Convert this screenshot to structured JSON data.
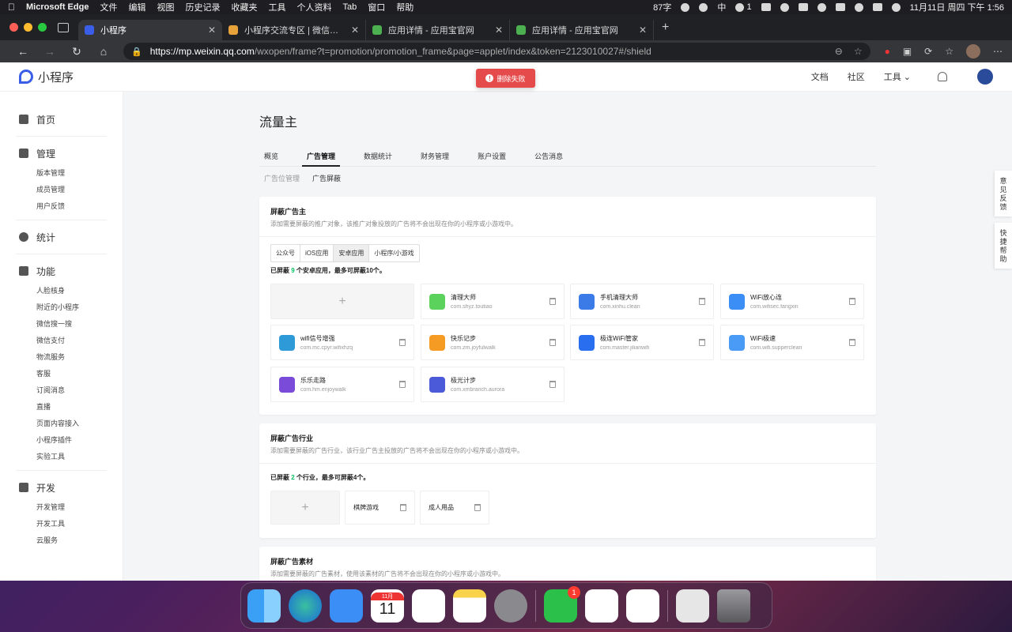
{
  "menubar": {
    "app": "Microsoft Edge",
    "items": [
      "文件",
      "编辑",
      "视图",
      "历史记录",
      "收藏夹",
      "工具",
      "个人资料",
      "Tab",
      "窗口",
      "帮助"
    ],
    "status_left": "87字",
    "status_ime": "中",
    "wechat_count": "1",
    "clock": "11月11日 周四 下午 1:56"
  },
  "browser": {
    "tabs": [
      {
        "title": "小程序",
        "color": "#3a5ee8"
      },
      {
        "title": "小程序交流专区 | 微信开放社区",
        "color": "#e8a23a"
      },
      {
        "title": "应用详情 - 应用宝官网",
        "color": "#4caf50"
      },
      {
        "title": "应用详情 - 应用宝官网",
        "color": "#4caf50"
      }
    ],
    "url_host": "https://mp.weixin.qq.com",
    "url_path": "/wxopen/frame?t=promotion/promotion_frame&page=applet/index&token=2123010027#/shield"
  },
  "topnav": {
    "logo": "小程序",
    "links": [
      "文档",
      "社区",
      "工具"
    ]
  },
  "toast": "删除失败",
  "sidebar": [
    {
      "title": "首页",
      "items": []
    },
    {
      "title": "管理",
      "items": [
        "版本管理",
        "成员管理",
        "用户反馈"
      ]
    },
    {
      "title": "统计",
      "items": []
    },
    {
      "title": "功能",
      "items": [
        "人脸核身",
        "附近的小程序",
        "微信搜一搜",
        "微信支付",
        "物流服务",
        "客服",
        "订阅消息",
        "直播",
        "页面内容接入",
        "小程序插件",
        "实验工具"
      ]
    },
    {
      "title": "开发",
      "items": [
        "开发管理",
        "开发工具",
        "云服务"
      ]
    }
  ],
  "main": {
    "title": "流量主",
    "tabs": [
      "概览",
      "广告管理",
      "数据统计",
      "财务管理",
      "账户设置",
      "公告消息"
    ],
    "subtabs": [
      "广告位管理",
      "广告屏蔽"
    ],
    "advertisers": {
      "heading": "屏蔽广告主",
      "desc": "添加需要屏蔽的推广对象，该推广对象投放的广告将不会出现在你的小程序或小游戏中。",
      "segments": [
        "公众号",
        "iOS应用",
        "安卓应用",
        "小程序/小游戏"
      ],
      "count_pre": "已屏蔽",
      "count_n": "9",
      "count_post": "个安卓应用，最多可屏蔽10个。",
      "apps": [
        {
          "name": "清理大师",
          "pkg": "com.shyz.toutiao",
          "color": "#5bd25b"
        },
        {
          "name": "手机清理大师",
          "pkg": "com.xinhu.clean",
          "color": "#3a7be8"
        },
        {
          "name": "WiFi放心连",
          "pkg": "com.wifisec.fangxin",
          "color": "#3a8ef6"
        },
        {
          "name": "wifi信号增强",
          "pkg": "com.mc.cpyr.wifixhzq",
          "color": "#2e9ad8"
        },
        {
          "name": "快乐记步",
          "pkg": "com.zm.joyfulwalk",
          "color": "#f59a23"
        },
        {
          "name": "极连WiFi管家",
          "pkg": "com.master.jilianwifi",
          "color": "#2a6ef0"
        },
        {
          "name": "WiFi极速",
          "pkg": "com.wifi.supperclean",
          "color": "#4a9bf5"
        },
        {
          "name": "乐乐走路",
          "pkg": "com.hm.enjoywalk",
          "color": "#7a4ad8"
        },
        {
          "name": "极光计步",
          "pkg": "com.xmbranch.aurora",
          "color": "#4a5ad8"
        }
      ]
    },
    "industries": {
      "heading": "屏蔽广告行业",
      "desc": "添加需要屏蔽的广告行业，该行业广告主投放的广告将不会出现在你的小程序或小游戏中。",
      "count_pre": "已屏蔽",
      "count_n": "2",
      "count_post": "个行业，最多可屏蔽4个。",
      "items": [
        "棋牌游戏",
        "成人用品"
      ]
    },
    "materials": {
      "heading": "屏蔽广告素材",
      "desc": "添加需要屏蔽的广告素材，使用该素材的广告将不会出现在你的小程序或小游戏中。"
    }
  },
  "side_tabs": [
    "意见反馈",
    "快捷帮助"
  ],
  "dock": {
    "calendar_month": "11月",
    "calendar_day": "11",
    "wechat_badge": "1"
  }
}
